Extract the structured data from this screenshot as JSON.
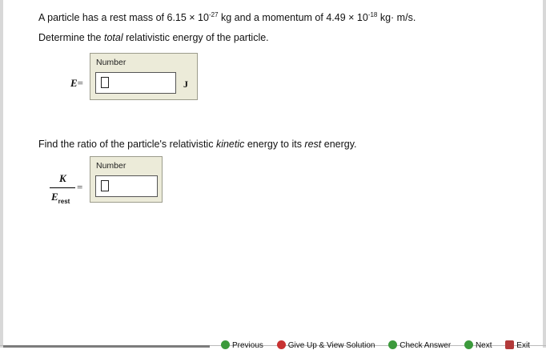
{
  "question1": {
    "prefix": "A particle has a rest mass of 6.15 × 10",
    "mass_exp": "-27",
    "mid": " kg and a momentum of 4.49 × 10",
    "mom_exp": "-18",
    "suffix": " kg· m/s."
  },
  "question1b": {
    "pre": "Determine the ",
    "em": "total",
    "post": " relativistic energy of the particle."
  },
  "answer1": {
    "variable": "E",
    "equals": "=",
    "box_label": "Number",
    "value": "",
    "unit": "J"
  },
  "question2": {
    "pre": "Find the ratio of the particle's relativistic ",
    "em1": "kinetic",
    "mid": " energy to its ",
    "em2": "rest",
    "post": " energy."
  },
  "answer2": {
    "numerator": "K",
    "denominator": "E",
    "denominator_sub": "rest",
    "equals": "=",
    "box_label": "Number",
    "value": ""
  },
  "nav": {
    "previous": "Previous",
    "give_up": "Give Up & View Solution",
    "check": "Check Answer",
    "next": "Next",
    "exit": "Exit"
  },
  "icons": {
    "previous": "arrow-left-icon",
    "give_up": "x-circle-icon",
    "check": "check-icon",
    "next": "arrow-right-icon",
    "exit": "exit-icon"
  },
  "colors": {
    "answer_box_bg": "#ecebd9",
    "nav_green": "#3c9a3c",
    "nav_red": "#c83232"
  }
}
